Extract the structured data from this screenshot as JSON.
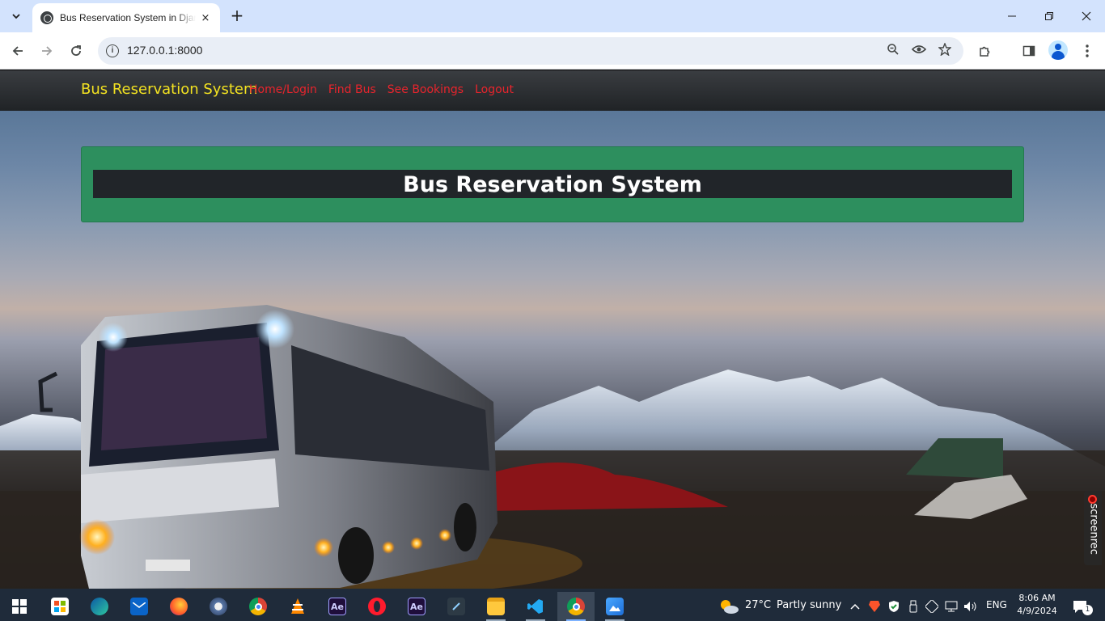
{
  "browser": {
    "tab_title": "Bus Reservation System in Django",
    "url": "127.0.0.1:8000",
    "new_tab_symbol": "+",
    "close_tab_symbol": "×"
  },
  "navbar": {
    "brand": "Bus Reservation System",
    "links": [
      "Home/Login",
      "Find Bus",
      "See Bookings",
      "Logout"
    ],
    "brand_color": "#f3e221",
    "link_color": "#e8242c"
  },
  "hero": {
    "title": "Bus Reservation System",
    "panel_color": "#2d8f5e",
    "title_bg": "#212529"
  },
  "overlay": {
    "screenrec_label": "screenrec"
  },
  "taskbar": {
    "apps": [
      "start-icon",
      "store-icon",
      "edge-icon",
      "mail-icon",
      "firefox-icon",
      "photo-icon",
      "chrome-icon",
      "vlc-icon",
      "after-effects-icon",
      "opera-icon",
      "after-effects-icon",
      "terminal-icon",
      "file-explorer-icon",
      "vscode-icon",
      "chrome-icon",
      "photos-icon"
    ],
    "ae_label": "Ae",
    "weather_temp": "27°C",
    "weather_text": "Partly sunny",
    "language": "ENG",
    "time": "8:06 AM",
    "date": "4/9/2024",
    "notification_count": "1"
  }
}
